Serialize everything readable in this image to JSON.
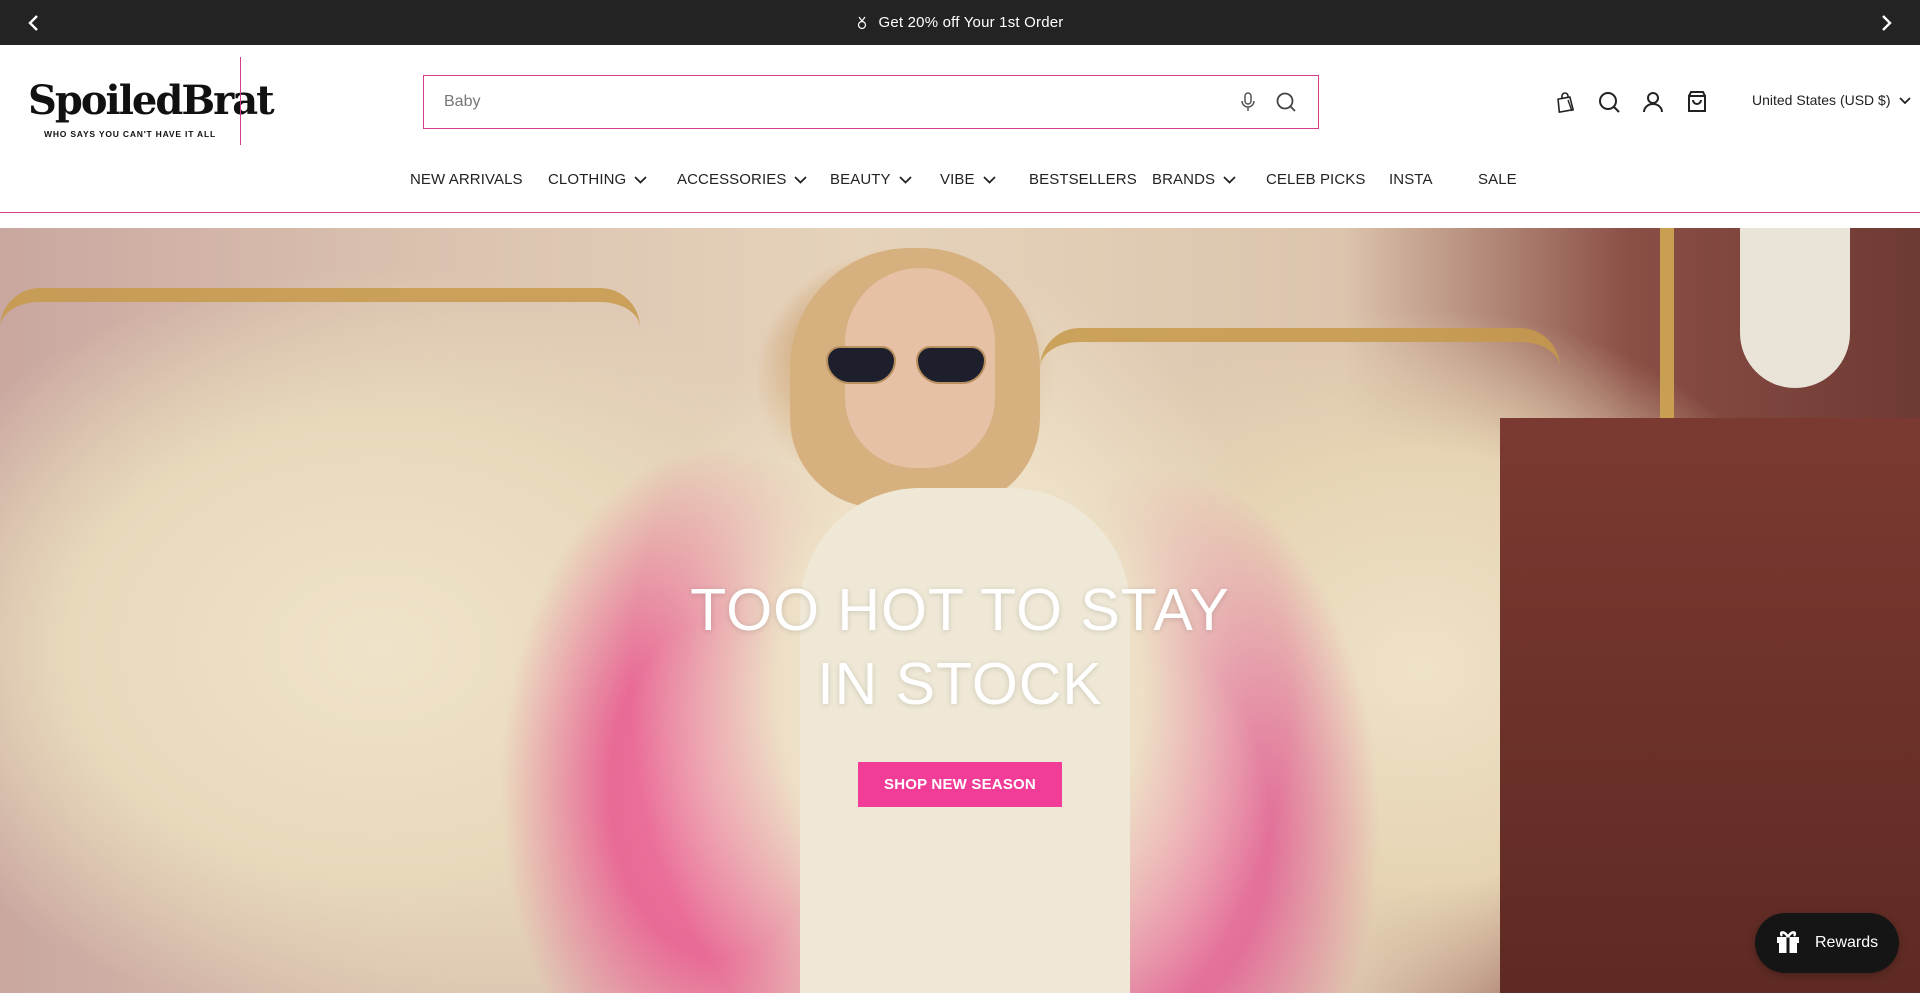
{
  "announcement": {
    "text": "Get 20% off Your 1st Order",
    "icon": "medal-icon"
  },
  "header": {
    "logo": {
      "wordmark": "SpoiledBrat",
      "tagline": "WHO SAYS YOU CAN'T HAVE IT ALL"
    },
    "search": {
      "placeholder": "Baby",
      "value": ""
    },
    "icons": [
      "wishlist-bag-icon",
      "search-icon",
      "account-icon",
      "cart-icon"
    ],
    "country": "United States (USD $)"
  },
  "nav": {
    "items": [
      {
        "label": "NEW ARRIVALS",
        "dropdown": false
      },
      {
        "label": "CLOTHING",
        "dropdown": true
      },
      {
        "label": "ACCESSORIES",
        "dropdown": true
      },
      {
        "label": "BEAUTY",
        "dropdown": true
      },
      {
        "label": "VIBE",
        "dropdown": true
      },
      {
        "label": "BESTSELLERS",
        "dropdown": false
      },
      {
        "label": "BRANDS",
        "dropdown": true
      },
      {
        "label": "CELEB PICKS",
        "dropdown": false
      },
      {
        "label": "INSTA",
        "dropdown": false
      },
      {
        "label": "SALE",
        "dropdown": false
      }
    ]
  },
  "hero": {
    "title_line1": "TOO HOT TO STAY",
    "title_line2": "IN STOCK",
    "cta": "SHOP NEW SEASON"
  },
  "rewards": {
    "label": "Rewards"
  },
  "colors": {
    "accent": "#f13c98",
    "border_pink": "#d63c8c",
    "topbar": "#232323"
  }
}
